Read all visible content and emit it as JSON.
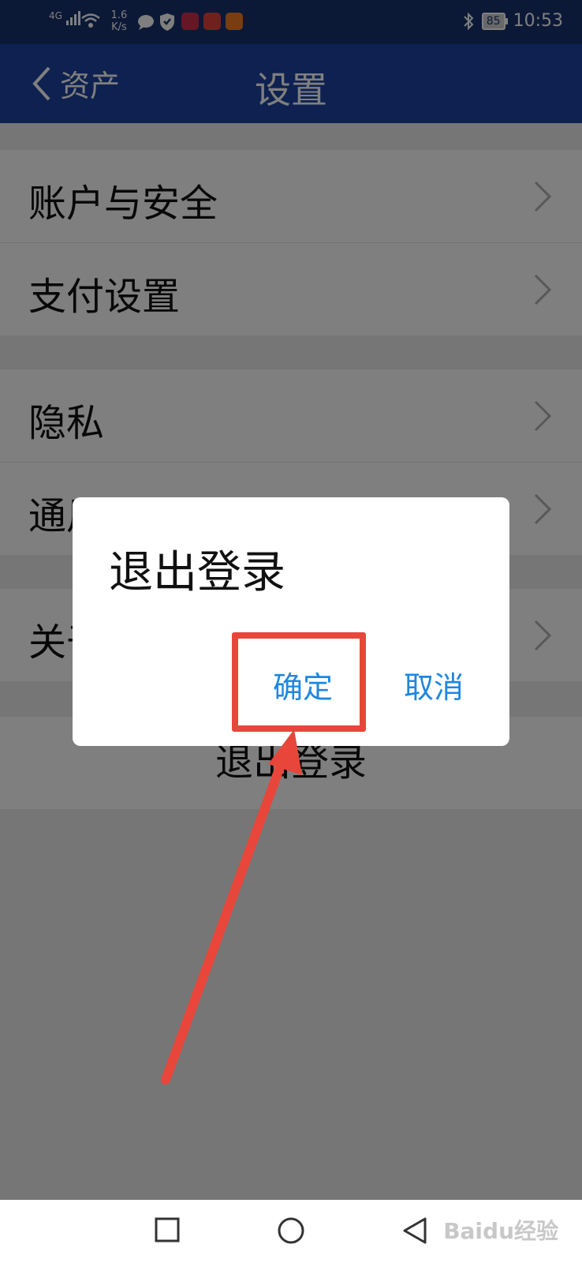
{
  "status_bar": {
    "network": "4G",
    "speed": "1.6 K/s",
    "battery": "85",
    "time": "10:53"
  },
  "nav": {
    "back_label": "资产",
    "title": "设置"
  },
  "settings": {
    "group1": [
      "账户与安全",
      "支付设置"
    ],
    "group2": [
      "隐私",
      "通用"
    ],
    "group3": [
      "关于"
    ],
    "logout_label": "退出登录"
  },
  "dialog": {
    "title": "退出登录",
    "confirm_label": "确定",
    "cancel_label": "取消"
  },
  "watermark": "Baidu经验",
  "colors": {
    "status_bar": "#17326f",
    "nav_bar": "#1d42a0",
    "dialog_button": "#1f86e0",
    "annotation": "#e8463a"
  }
}
